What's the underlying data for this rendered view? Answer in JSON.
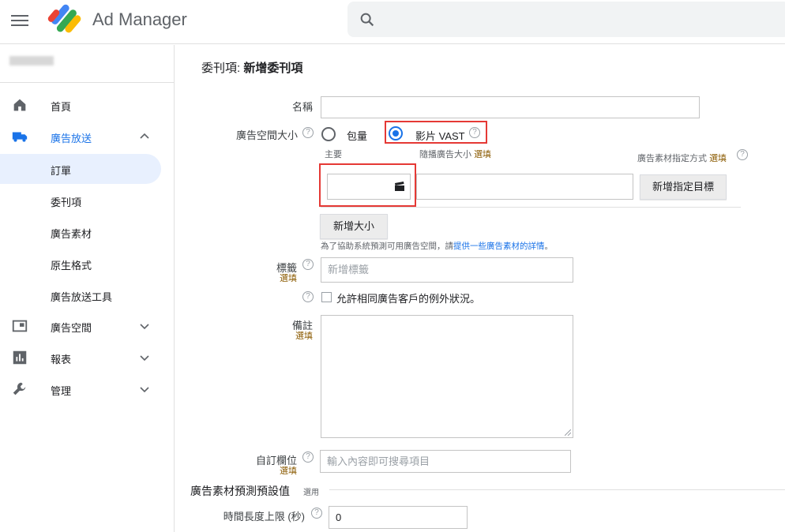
{
  "app": {
    "title": "Ad Manager"
  },
  "nav": {
    "items": [
      {
        "label": "首頁",
        "icon": "home-icon"
      },
      {
        "label": "廣告放送",
        "icon": "delivery-truck-icon"
      },
      {
        "label": "訂單"
      },
      {
        "label": "委刊項"
      },
      {
        "label": "廣告素材"
      },
      {
        "label": "原生格式"
      },
      {
        "label": "廣告放送工具"
      },
      {
        "label": "廣告空間",
        "icon": "inventory-icon"
      },
      {
        "label": "報表",
        "icon": "reports-icon"
      },
      {
        "label": "管理",
        "icon": "wrench-icon"
      }
    ]
  },
  "page": {
    "title_prefix": "委刊項: ",
    "title_main": "新增委刊項"
  },
  "form": {
    "name_label": "名稱",
    "inventory_size_label": "廣告空間大小",
    "radio_standard": "包量",
    "radio_video": "影片 VAST",
    "primary_label": "主要",
    "companion_label": "隨播廣告大小",
    "companion_optional": "選填",
    "creative_targeting_label": "廣告素材指定方式",
    "creative_targeting_optional": "選填",
    "add_targeting_button": "新增指定目標",
    "add_size_button": "新增大小",
    "help_prefix": "為了協助系統預測可用廣告空間，請",
    "help_link": "提供一些廣告素材的詳情",
    "help_suffix": "。",
    "labels_label": "標籤",
    "labels_optional": "選填",
    "labels_placeholder": "新增標籤",
    "allow_same_advertiser": "允許相同廣告客戶的例外狀況。",
    "comments_label": "備註",
    "comments_optional": "選填",
    "custom_fields_label": "自訂欄位",
    "custom_fields_optional": "選填",
    "custom_fields_placeholder": "輸入內容即可搜尋項目",
    "section_title": "廣告素材預測預設值",
    "section_optional": "選用",
    "duration_label": "時間長度上限 (秒)",
    "duration_value": "0"
  },
  "colors": {
    "accent": "#1a73e8",
    "highlight": "#e53935",
    "optional": "#8a5a00"
  }
}
